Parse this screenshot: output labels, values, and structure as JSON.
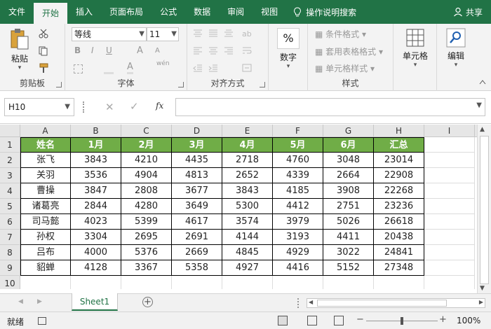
{
  "tabs": [
    {
      "label": "文件",
      "active": false
    },
    {
      "label": "开始",
      "active": true
    },
    {
      "label": "插入",
      "active": false
    },
    {
      "label": "页面布局",
      "active": false
    },
    {
      "label": "公式",
      "active": false
    },
    {
      "label": "数据",
      "active": false
    },
    {
      "label": "审阅",
      "active": false
    },
    {
      "label": "视图",
      "active": false
    }
  ],
  "tell_me": "操作说明搜索",
  "share": "共享",
  "ribbon": {
    "clipboard": {
      "paste": "粘贴",
      "group": "剪贴板"
    },
    "font": {
      "name": "等线",
      "size": "11",
      "group": "字体",
      "bold": "B",
      "italic": "I",
      "underline": "U",
      "grow": "A",
      "shrink": "A",
      "wen": "wén"
    },
    "alignment": {
      "group": "对齐方式"
    },
    "number": {
      "percent": "%",
      "label": "数字"
    },
    "styles": {
      "conditional": "条件格式",
      "table": "套用表格格式",
      "cell": "单元格样式",
      "group": "样式"
    },
    "cells": {
      "label": "单元格"
    },
    "editing": {
      "label": "编辑"
    }
  },
  "formula_bar": {
    "name_box": "H10",
    "fx": "fx",
    "value": ""
  },
  "columns": [
    "A",
    "B",
    "C",
    "D",
    "E",
    "F",
    "G",
    "H",
    "I"
  ],
  "rows": [
    "1",
    "2",
    "3",
    "4",
    "5",
    "6",
    "7",
    "8",
    "9",
    "10"
  ],
  "table": {
    "header": [
      "姓名",
      "1月",
      "2月",
      "3月",
      "4月",
      "5月",
      "6月",
      "汇总"
    ],
    "data": [
      [
        "张飞",
        "3843",
        "4210",
        "4435",
        "2718",
        "4760",
        "3048",
        "23014"
      ],
      [
        "关羽",
        "3536",
        "4904",
        "4813",
        "2652",
        "4339",
        "2664",
        "22908"
      ],
      [
        "曹操",
        "3847",
        "2808",
        "3677",
        "3843",
        "4185",
        "3908",
        "22268"
      ],
      [
        "诸葛亮",
        "2844",
        "4280",
        "3649",
        "5300",
        "4412",
        "2751",
        "23236"
      ],
      [
        "司马懿",
        "4023",
        "5399",
        "4617",
        "3574",
        "3979",
        "5026",
        "26618"
      ],
      [
        "孙权",
        "3304",
        "2695",
        "2691",
        "4144",
        "3193",
        "4411",
        "20438"
      ],
      [
        "吕布",
        "4000",
        "5376",
        "2669",
        "4845",
        "4929",
        "3022",
        "24841"
      ],
      [
        "貂蝉",
        "4128",
        "3367",
        "5358",
        "4927",
        "4416",
        "5152",
        "27348"
      ]
    ]
  },
  "sheet_tab": "Sheet1",
  "status": {
    "ready": "就绪",
    "zoom": "100%"
  },
  "colors": {
    "brand": "#217346",
    "header_fill": "#70ad47"
  }
}
